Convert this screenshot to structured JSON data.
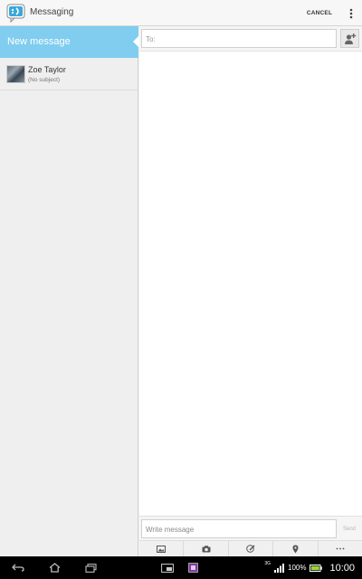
{
  "header": {
    "app_title": "Messaging",
    "cancel_label": "CANCEL"
  },
  "sidebar": {
    "new_message_label": "New message",
    "conversations": [
      {
        "name": "Zoe Taylor",
        "subject": "(No subject)"
      }
    ]
  },
  "compose": {
    "to_placeholder": "To:",
    "write_placeholder": "Write message",
    "send_label": "Send"
  },
  "attachments": [
    "picture-icon",
    "camera-icon",
    "sketch-icon",
    "location-icon",
    "more-icon"
  ],
  "status_bar": {
    "network": "3G",
    "battery_percent": "100%",
    "time": "10:00"
  },
  "colors": {
    "accent": "#80cdf0",
    "battery": "#9bd33a"
  }
}
